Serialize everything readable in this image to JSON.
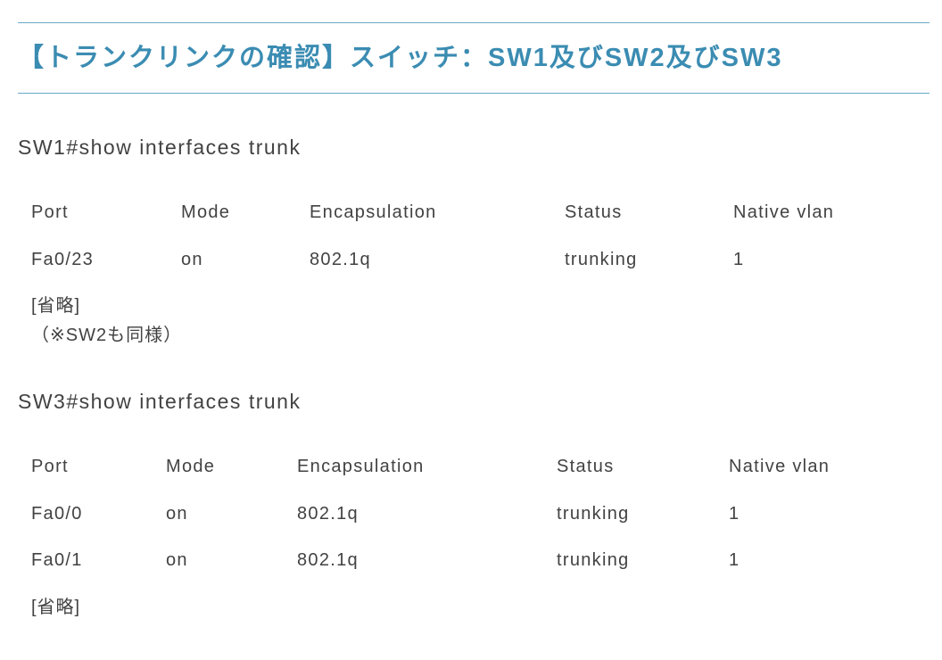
{
  "heading": "【トランクリンクの確認】スイッチ：SW1及びSW2及びSW3",
  "colors": {
    "accent": "#3b8cb2",
    "rule": "#69aac8",
    "text": "#424242",
    "background": "#ffffff"
  },
  "sections": [
    {
      "command": "SW1#show interfaces trunk",
      "columns": [
        "Port",
        "Mode",
        "Encapsulation",
        "Status",
        "Native vlan"
      ],
      "rows": [
        [
          "Fa0/23",
          "on",
          "802.1q",
          "trunking",
          "1"
        ]
      ],
      "omitted": "[省略]",
      "note": "（※SW2も同様）"
    },
    {
      "command": "SW3#show interfaces trunk",
      "columns": [
        "Port",
        "Mode",
        "Encapsulation",
        "Status",
        "Native vlan"
      ],
      "rows": [
        [
          "Fa0/0",
          "on",
          "802.1q",
          "trunking",
          "1"
        ],
        [
          "Fa0/1",
          "on",
          "802.1q",
          "trunking",
          "1"
        ]
      ],
      "omitted": "[省略]"
    }
  ]
}
